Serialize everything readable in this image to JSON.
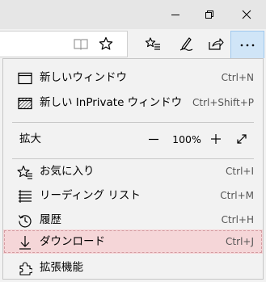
{
  "titlebar": {
    "buttons": [
      {
        "name": "minimize-button",
        "icon": "minimize-icon"
      },
      {
        "name": "restore-button",
        "icon": "restore-icon"
      },
      {
        "name": "close-button",
        "icon": "close-icon"
      }
    ]
  },
  "toolbar": {
    "icons": [
      "reading-view-icon",
      "favorite-star-icon",
      "favorites-list-icon",
      "web-note-icon",
      "share-icon",
      "more-dots-icon"
    ],
    "more_label": "···"
  },
  "menu": {
    "items": [
      {
        "label": "新しいウィンドウ",
        "shortcut": "Ctrl+N",
        "icon": "new-window-icon"
      },
      {
        "label": "新しい InPrivate ウィンドウ",
        "shortcut": "Ctrl+Shift+P",
        "icon": "inprivate-window-icon"
      }
    ],
    "zoom": {
      "label": "拡大",
      "minus": "—",
      "value": "100%",
      "plus": "+",
      "fullscreen_icon": "fullscreen-icon"
    },
    "items2": [
      {
        "label": "お気に入り",
        "shortcut": "Ctrl+I",
        "icon": "favorites-icon"
      },
      {
        "label": "リーディング リスト",
        "shortcut": "Ctrl+M",
        "icon": "reading-list-icon"
      },
      {
        "label": "履歴",
        "shortcut": "Ctrl+H",
        "icon": "history-icon"
      },
      {
        "label": "ダウンロード",
        "shortcut": "Ctrl+J",
        "icon": "download-icon",
        "highlighted": true
      },
      {
        "label": "拡張機能",
        "shortcut": "",
        "icon": "extensions-icon"
      }
    ],
    "highlight_color": "#f5d6d8"
  }
}
